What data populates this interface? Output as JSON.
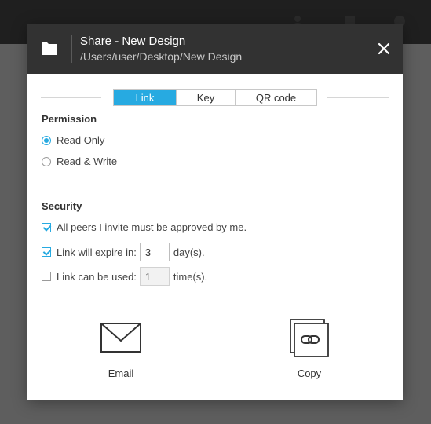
{
  "dialog": {
    "title": "Share - New Design",
    "path": "/Users/user/Desktop/New Design"
  },
  "tabs": [
    {
      "label": "Link",
      "active": true
    },
    {
      "label": "Key",
      "active": false
    },
    {
      "label": "QR code",
      "active": false
    }
  ],
  "permission": {
    "title": "Permission",
    "options": [
      {
        "label": "Read Only",
        "selected": true
      },
      {
        "label": "Read & Write",
        "selected": false
      }
    ]
  },
  "security": {
    "title": "Security",
    "approve": {
      "label": "All peers I invite must be approved by me.",
      "checked": true
    },
    "expire": {
      "label": "Link will expire in:",
      "value": "3",
      "unit": "day(s).",
      "checked": true
    },
    "uses": {
      "label": "Link can be used:",
      "placeholder": "1",
      "unit": "time(s).",
      "checked": false
    }
  },
  "actions": {
    "email_label": "Email",
    "copy_label": "Copy"
  },
  "colors": {
    "accent": "#27aae1",
    "header_bg": "#323232"
  },
  "icons": [
    "folder-icon",
    "close-icon",
    "email-icon",
    "copy-link-icon"
  ]
}
